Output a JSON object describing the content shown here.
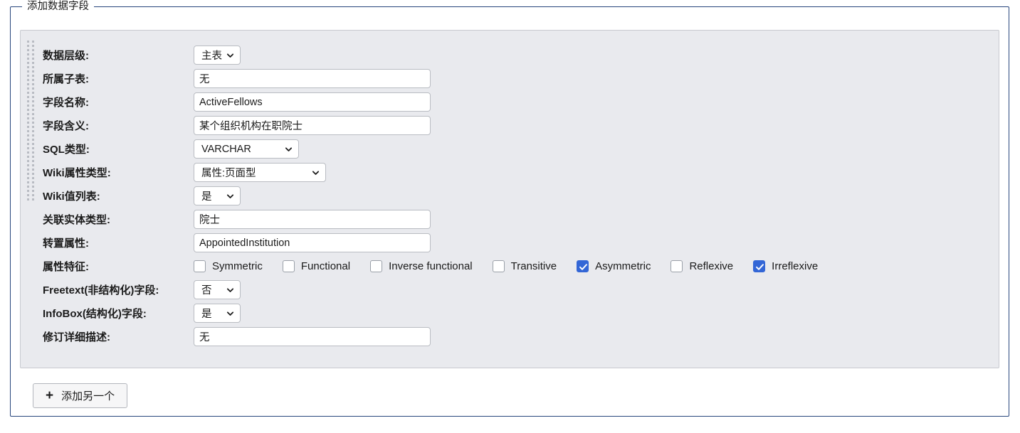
{
  "fieldset": {
    "legend": "添加数据字段"
  },
  "form": {
    "rows": [
      {
        "label": "数据层级:",
        "control": "select",
        "value": "主表",
        "width": "sm"
      },
      {
        "label": "所属子表:",
        "control": "text",
        "value": "无"
      },
      {
        "label": "字段名称:",
        "control": "text",
        "value": "ActiveFellows"
      },
      {
        "label": "字段含义:",
        "control": "text",
        "value": "某个组织机构在职院士"
      },
      {
        "label": "SQL类型:",
        "control": "select",
        "value": "VARCHAR",
        "width": "md"
      },
      {
        "label": "Wiki属性类型:",
        "control": "select",
        "value": "属性:页面型",
        "width": "lg"
      },
      {
        "label": "Wiki值列表:",
        "control": "select",
        "value": "是",
        "width": "sm"
      },
      {
        "label": "关联实体类型:",
        "control": "text",
        "value": "院士"
      },
      {
        "label": "转置属性:",
        "control": "text",
        "value": "AppointedInstitution"
      },
      {
        "label": "属性特征:",
        "control": "checkboxes"
      },
      {
        "label": "Freetext(非结构化)字段:",
        "control": "select",
        "value": "否",
        "width": "sm"
      },
      {
        "label": "InfoBox(结构化)字段:",
        "control": "select",
        "value": "是",
        "width": "sm"
      },
      {
        "label": "修订详细描述:",
        "control": "text",
        "value": "无"
      }
    ],
    "characteristics": [
      {
        "label": "Symmetric",
        "checked": false
      },
      {
        "label": "Functional",
        "checked": false
      },
      {
        "label": "Inverse functional",
        "checked": false
      },
      {
        "label": "Transitive",
        "checked": false
      },
      {
        "label": "Asymmetric",
        "checked": true
      },
      {
        "label": "Reflexive",
        "checked": false
      },
      {
        "label": "Irreflexive",
        "checked": true
      }
    ]
  },
  "buttons": {
    "add_another": "添加另一个",
    "add_another_icon": "plus-icon"
  },
  "colors": {
    "fieldset_border": "#27457c",
    "panel_bg": "#e9eaee",
    "panel_border": "#c8cad0",
    "checkbox_checked": "#3366d6",
    "input_border": "#b9bcc2",
    "text": "#1b1b1b"
  }
}
